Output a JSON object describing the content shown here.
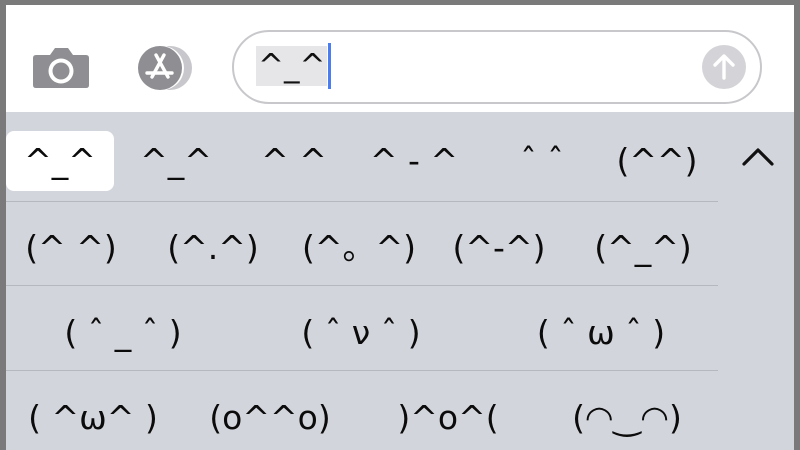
{
  "toolbar": {
    "camera_icon": "camera-icon",
    "appstore_icon": "app-store-icon",
    "input_value": "^_^",
    "send_icon": "arrow-up-icon"
  },
  "suggestions": {
    "row1": [
      "^_^",
      "^_^",
      "^ ^",
      "^ - ^",
      "ˆ ˆ",
      "(^^)"
    ],
    "row2": [
      "(^ ^)",
      "(^.^)",
      "(^。^)",
      "(^-^)",
      "(^_^)"
    ],
    "row3": [
      "( ˆ _ ˆ )",
      "( ˆ ν ˆ )",
      "( ˆ ω ˆ )"
    ],
    "row4": [
      "( ^ω^ )",
      "(o^^o)",
      ")^o^(",
      "(◠‿◠)"
    ],
    "expand_icon": "chevron-up-icon"
  },
  "colors": {
    "keyboard_bg": "#d3d5dc",
    "caret": "#4a7df0",
    "send_button": "#d4d4d8"
  }
}
